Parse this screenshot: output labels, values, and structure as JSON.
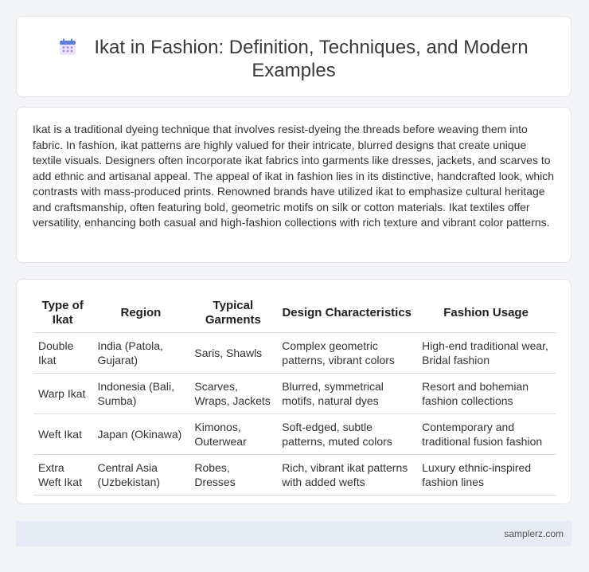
{
  "title": "Ikat in Fashion: Definition, Techniques, and Modern Examples",
  "description": "Ikat is a traditional dyeing technique that involves resist-dyeing the threads before weaving them into fabric. In fashion, ikat patterns are highly valued for their intricate, blurred designs that create unique textile visuals. Designers often incorporate ikat fabrics into garments like dresses, jackets, and scarves to add ethnic and artisanal appeal. The appeal of ikat in fashion lies in its distinctive, handcrafted look, which contrasts with mass-produced prints. Renowned brands have utilized ikat to emphasize cultural heritage and craftsmanship, often featuring bold, geometric motifs on silk or cotton materials. Ikat textiles offer versatility, enhancing both casual and high-fashion collections with rich texture and vibrant color patterns.",
  "table": {
    "headers": [
      "Type of Ikat",
      "Region",
      "Typical Garments",
      "Design Characteristics",
      "Fashion Usage"
    ],
    "rows": [
      [
        "Double Ikat",
        "India (Patola, Gujarat)",
        "Saris, Shawls",
        "Complex geometric patterns, vibrant colors",
        "High-end traditional wear, Bridal fashion"
      ],
      [
        "Warp Ikat",
        "Indonesia (Bali, Sumba)",
        "Scarves, Wraps, Jackets",
        "Blurred, symmetrical motifs, natural dyes",
        "Resort and bohemian fashion collections"
      ],
      [
        "Weft Ikat",
        "Japan (Okinawa)",
        "Kimonos, Outerwear",
        "Soft-edged, subtle patterns, muted colors",
        "Contemporary and traditional fusion fashion"
      ],
      [
        "Extra Weft Ikat",
        "Central Asia (Uzbekistan)",
        "Robes, Dresses",
        "Rich, vibrant ikat patterns with added wefts",
        "Luxury ethnic-inspired fashion lines"
      ]
    ]
  },
  "footer": {
    "site": "samplerz.com"
  },
  "icons": {
    "title_icon": "calendar-icon"
  },
  "colors": {
    "icon_blue": "#5b7fe0",
    "icon_purple": "#a47de8",
    "footer_bg": "#e6ebf5"
  }
}
